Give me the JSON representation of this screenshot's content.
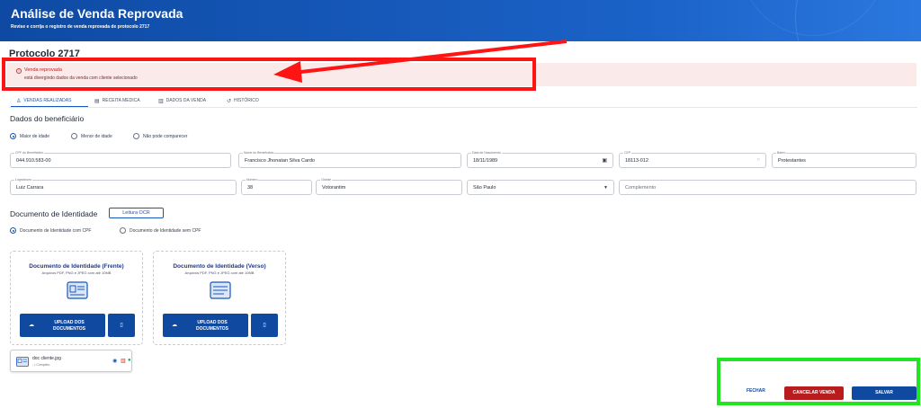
{
  "header": {
    "title": "Análise de Venda Reprovada",
    "subtitle": "Revise e corrija o registro de venda reprovada de protocolo 2717"
  },
  "protocol_title": "Protocolo 2717",
  "alert": {
    "title": "Venda reprovada",
    "message": "está divergindo dados da venda com cliente selecionado",
    "icon": "info-circle-icon",
    "color": "#b91c1c"
  },
  "tabs": [
    {
      "label": "VENDAS REALIZADAS",
      "icon": "person-icon",
      "active": true
    },
    {
      "label": "RECEITA MEDICA",
      "icon": "document-icon",
      "active": false
    },
    {
      "label": "DADOS DA VENDA",
      "icon": "list-icon",
      "active": false
    },
    {
      "label": "HISTÓRICO",
      "icon": "history-icon",
      "active": false
    }
  ],
  "beneficiary": {
    "title": "Dados do beneficiário",
    "age_options": [
      {
        "label": "Maior de idade",
        "checked": true
      },
      {
        "label": "Menor de idade",
        "checked": false
      },
      {
        "label": "Não pode comparecer",
        "checked": false
      }
    ],
    "fields": {
      "cpf": {
        "label": "CPF do Beneficiário",
        "value": "044.910.583-00"
      },
      "name": {
        "label": "Nome do Beneficiário",
        "value": "Francisco Jhonatan Silva Cardo"
      },
      "birth": {
        "label": "Data de Nascimento",
        "value": "18/11/1989"
      },
      "cep": {
        "label": "CEP",
        "value": "18113-012"
      },
      "neighborhood": {
        "label": "Bairro",
        "value": "Protestantes"
      },
      "street": {
        "label": "Logradouro",
        "value": "Luiz Carrara"
      },
      "number": {
        "label": "Número",
        "value": "38"
      },
      "city": {
        "label": "Cidade",
        "value": "Votorantim"
      },
      "state": {
        "label": "",
        "value": "São Paulo"
      },
      "complement": {
        "label": "",
        "placeholder": "Complemento"
      }
    }
  },
  "document": {
    "title": "Documento de Identidade",
    "ocr_button": "Leitura OCR",
    "type_options": [
      {
        "label": "Documento de Identidade com CPF",
        "checked": true
      },
      {
        "label": "Documento de Identidade sem CPF",
        "checked": false
      }
    ],
    "cards": [
      {
        "title": "Documento de Identidade (Frente)",
        "subtitle": "Arquivos PDF, PNG e JPEG com até 10MB",
        "upload_label": "UPLOAD DOS DOCUMENTOS"
      },
      {
        "title": "Documento de Identidade (Verso)",
        "subtitle": "Arquivos PDF, PNG e JPEG com até 10MB",
        "upload_label": "UPLOAD DOS DOCUMENTOS"
      }
    ],
    "file": {
      "name": "doc cliente.jpg",
      "status": "- • Completo"
    }
  },
  "actions": {
    "close": "FECHAR",
    "cancel_sale": "CANCELAR VENDA",
    "save": "SALVAR",
    "cancel_color": "#b91c1c",
    "primary_color": "#0f4aa0"
  },
  "annotations": {
    "red_box_color": "#ff1414",
    "green_box_color": "#22e522"
  }
}
